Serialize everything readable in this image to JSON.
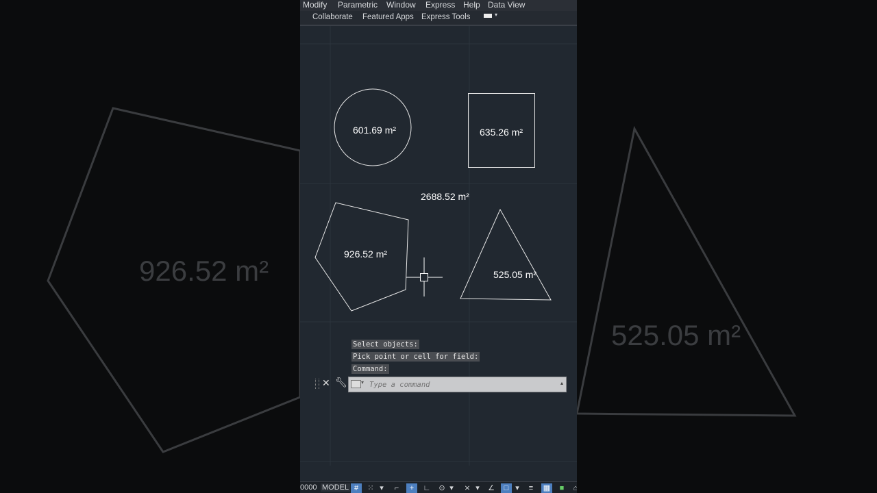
{
  "menu": [
    "Modify",
    "Parametric",
    "Window",
    "Express",
    "Help",
    "Data View"
  ],
  "ribbon_tabs": [
    "Collaborate",
    "Featured Apps",
    "Express Tools"
  ],
  "drawing": {
    "circle_area": "601.69 m²",
    "square_area": "635.26 m²",
    "total_area": "2688.52 m²",
    "pentagon_area": "926.52 m²",
    "triangle_area": "525.05 m²"
  },
  "background_labels": {
    "left": "926.52 m²",
    "right": "525.05 m²"
  },
  "command_history": [
    "Select objects:",
    "Pick point or cell for field:",
    "Command:"
  ],
  "command_input": {
    "placeholder": "Type a command",
    "value": ""
  },
  "status": {
    "coords": "0000",
    "model": "MODEL"
  }
}
